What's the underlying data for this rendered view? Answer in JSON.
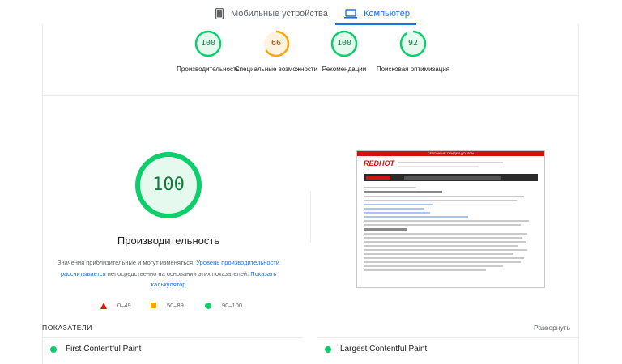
{
  "tabs": {
    "mobile_label": "Мобильные устройства",
    "desktop_label": "Компьютер"
  },
  "categories": [
    {
      "score": "100",
      "label": "Производительность",
      "color": "#0cce6b"
    },
    {
      "score": "66",
      "label": "Специальные возможности",
      "color": "#ffa400"
    },
    {
      "score": "100",
      "label": "Рекомендации",
      "color": "#0cce6b"
    },
    {
      "score": "92",
      "label": "Поисковая оптимизация",
      "color": "#0cce6b"
    }
  ],
  "performance": {
    "score": "100",
    "title": "Производительность",
    "desc_prefix": "Значения приблизительные и могут изменяться.",
    "desc_link1": "Уровень производительности рассчитывается",
    "desc_middle": "непосредственно на основании этих показателей.",
    "desc_link2": "Показать калькулятор"
  },
  "legend": {
    "low": "0–49",
    "mid": "50–89",
    "high": "90–100"
  },
  "screenshot": {
    "banner": "СЕЗОННЫЕ СКИДКИ ДО -80%",
    "logo": "REDHOT"
  },
  "metrics_section": {
    "title": "ПОКАЗАТЕЛИ",
    "expand_label": "Развернуть",
    "items": [
      {
        "label": "First Contentful Paint"
      },
      {
        "label": "Largest Contentful Paint"
      }
    ]
  },
  "colors": {
    "accent": "#1a73e8",
    "pass": "#0cce6b",
    "average": "#ffa400",
    "fail": "#eb0f00"
  }
}
